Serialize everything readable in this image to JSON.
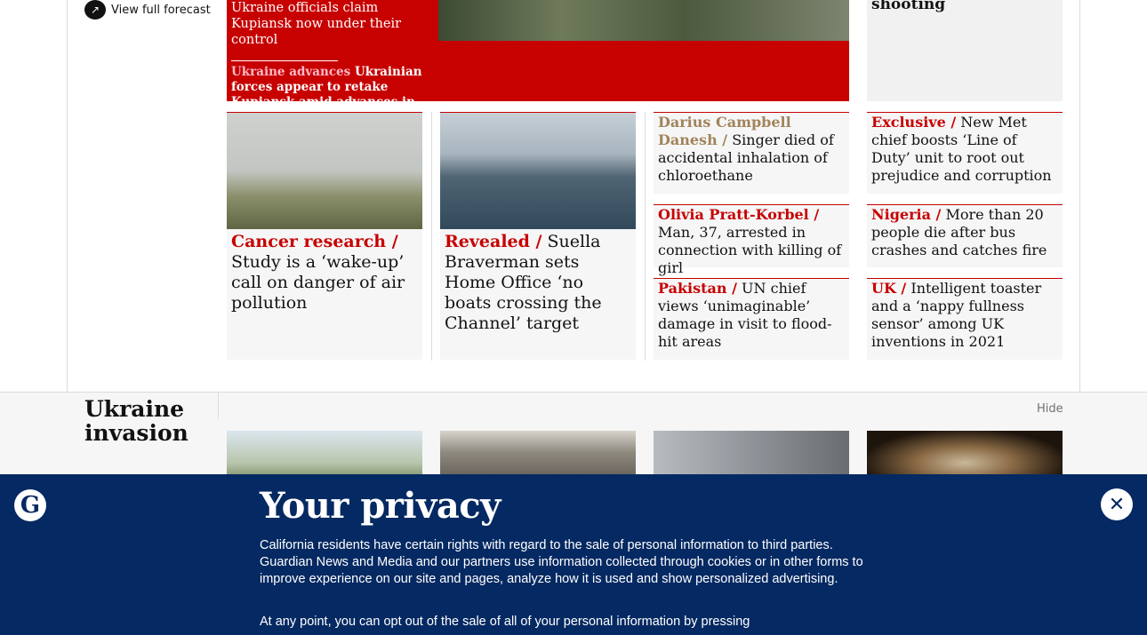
{
  "weather": {
    "forecast_label": "View full forecast",
    "icon": "external-link-icon"
  },
  "hero": {
    "headline": "Ukraine officials claim Kupiansk now under their control",
    "sub_kicker": "Ukraine advances",
    "sub_text": "Ukrainian forces appear to retake Kupiansk amid advances in north-east"
  },
  "top_right": {
    "text": "shooting"
  },
  "cards": [
    {
      "kicker": "Cancer research /",
      "text": "Study is a ‘wake-up’ call on danger of air pollution"
    },
    {
      "kicker": "Revealed /",
      "text": "Suella Braverman sets Home Office ‘no boats crossing the Channel’ target"
    },
    {
      "kicker": "Darius Campbell Danesh /",
      "text": "Singer died of accidental inhalation of chloroethane"
    },
    {
      "kicker": "Exclusive /",
      "text": "New Met chief boosts ‘Line of Duty’ unit to root out prejudice and corruption"
    },
    {
      "kicker": "Olivia Pratt-Korbel /",
      "text": "Man, 37, arrested in connection with killing of girl"
    },
    {
      "kicker": "Nigeria /",
      "text": "More than 20 people die after bus crashes and catches fire"
    },
    {
      "kicker": "Pakistan /",
      "text": "UN chief views ‘unimaginable’ damage in visit to flood-hit areas"
    },
    {
      "kicker": "UK /",
      "text": "Intelligent toaster and a ‘nappy fullness sensor’ among UK inventions in 2021"
    }
  ],
  "section": {
    "title": "Ukraine invasion",
    "hide_label": "Hide"
  },
  "privacy": {
    "title": "Your privacy",
    "para1": "California residents have certain rights with regard to the sale of personal information to third parties. Guardian News and Media and our partners use information collected through cookies or in other forms to improve experience on our site and pages, analyze how it is used and show personalized advertising.",
    "para2": "At any point, you can opt out of the sale of all of your personal information by pressing",
    "logo_letter": "G",
    "close_icon": "close-icon"
  },
  "colors": {
    "news_red": "#c70000",
    "guardian_blue": "#052962",
    "accent_gold": "#a1845c"
  }
}
